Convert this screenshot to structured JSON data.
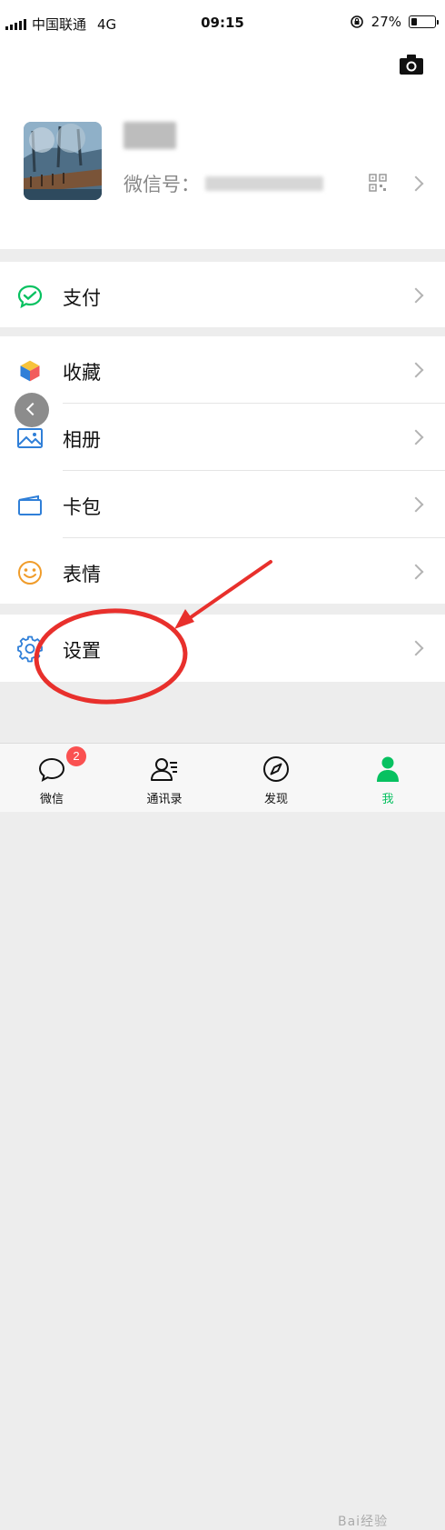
{
  "status_bar": {
    "carrier": "中国联通",
    "network": "4G",
    "time": "09:15",
    "battery_percent": "27%",
    "battery_level": 0.27
  },
  "profile": {
    "wechat_id_label": "微信号："
  },
  "menu": {
    "pay": {
      "label": "支付",
      "icon": "wechat-pay-icon"
    },
    "favorites": {
      "label": "收藏",
      "icon": "cube-icon"
    },
    "album": {
      "label": "相册",
      "icon": "photo-icon"
    },
    "cards": {
      "label": "卡包",
      "icon": "card-wallet-icon"
    },
    "stickers": {
      "label": "表情",
      "icon": "smile-icon"
    },
    "settings": {
      "label": "设置",
      "icon": "gear-icon"
    }
  },
  "tabs": [
    {
      "label": "微信",
      "icon": "chat-bubble-icon",
      "badge": "2"
    },
    {
      "label": "通讯录",
      "icon": "contacts-icon"
    },
    {
      "label": "发现",
      "icon": "compass-icon"
    },
    {
      "label": "我",
      "icon": "person-icon",
      "active": true
    }
  ],
  "watermark": "Bai经验",
  "colors": {
    "accent_green": "#07c160",
    "badge_red": "#fa5151",
    "annotation_red": "#e8302c",
    "icon_blue": "#2f7fd8",
    "icon_orange": "#f09c2a"
  }
}
